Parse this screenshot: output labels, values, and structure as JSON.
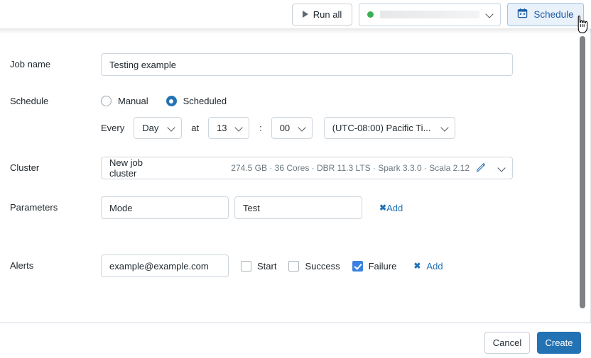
{
  "toolbar": {
    "run_all_label": "Run all",
    "cluster_status_dot_color": "#3caf55",
    "cluster_selector_value": "",
    "schedule_label": "Schedule",
    "schedule_accent": "#1f5fa8"
  },
  "form": {
    "job_name": {
      "label": "Job name",
      "value": "Testing example",
      "placeholder": "Job name"
    },
    "schedule": {
      "label": "Schedule",
      "options": [
        {
          "label": "Manual",
          "selected": false
        },
        {
          "label": "Scheduled",
          "selected": true
        }
      ],
      "every_label": "Every",
      "period_value": "Day",
      "at_label": "at",
      "hour_value": "13",
      "colon": ":",
      "minute_value": "00",
      "timezone_value": "(UTC-08:00) Pacific Ti..."
    },
    "cluster": {
      "label": "Cluster",
      "name": "New job cluster",
      "specs": "274.5 GB · 36 Cores · DBR 11.3 LTS · Spark 3.3.0 · Scala 2.12"
    },
    "parameters": {
      "label": "Parameters",
      "key_value": "Test",
      "name_value": "Mode",
      "remove_glyph": "✖",
      "add_label": "Add"
    },
    "alerts": {
      "label": "Alerts",
      "email_value": "example@example.com",
      "checkboxes": [
        {
          "label": "Start",
          "checked": false
        },
        {
          "label": "Success",
          "checked": false
        },
        {
          "label": "Failure",
          "checked": true
        }
      ],
      "remove_glyph": "✖",
      "add_label": "Add",
      "checked_color": "#3b82e0"
    }
  },
  "footer": {
    "cancel_label": "Cancel",
    "create_label": "Create",
    "create_color": "#2272b4"
  }
}
